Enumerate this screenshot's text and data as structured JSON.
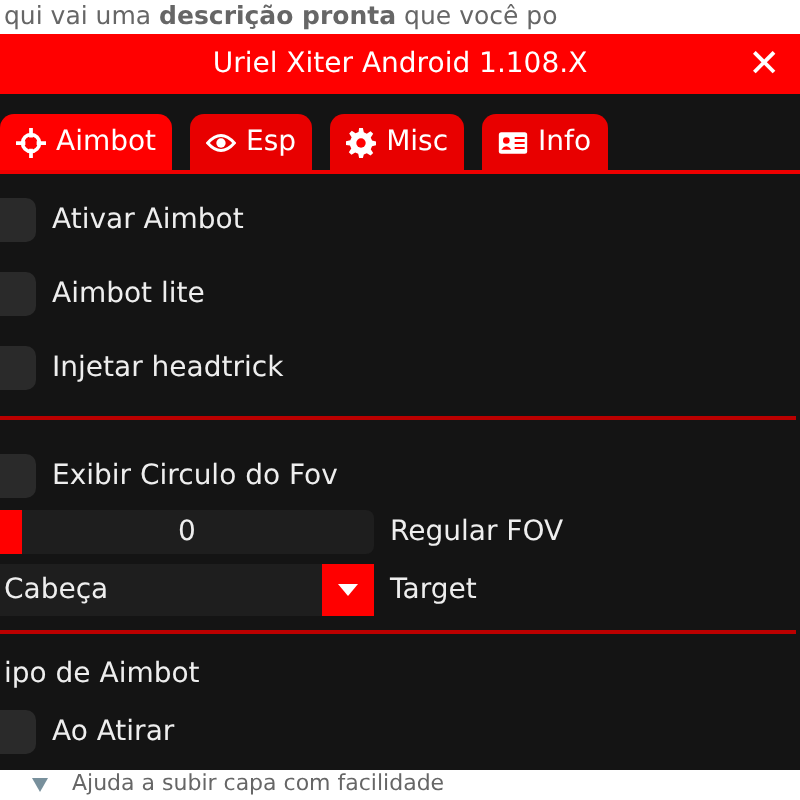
{
  "page_text_top": "qui vai uma **descrição pronta** que você po",
  "window": {
    "title": "Uriel Xiter Android 1.108.X",
    "close": "✕"
  },
  "tabs": [
    {
      "label": "Aimbot",
      "selected": true
    },
    {
      "label": "Esp",
      "selected": false
    },
    {
      "label": "Misc",
      "selected": false
    },
    {
      "label": "Info",
      "selected": false
    }
  ],
  "items": [
    {
      "kind": "checkbox",
      "label": "Ativar Aimbot",
      "checked": false
    },
    {
      "kind": "checkbox",
      "label": "Aimbot lite",
      "checked": false
    },
    {
      "kind": "checkbox",
      "label": "Injetar headtrick",
      "checked": false
    },
    {
      "kind": "divider"
    },
    {
      "kind": "checkbox",
      "label": "Exibir Circulo do Fov",
      "checked": false
    },
    {
      "kind": "slider",
      "reading": "0",
      "label": "Regular FOV",
      "level": 0
    },
    {
      "kind": "dropdown",
      "value": "Cabeça",
      "label": "Target"
    },
    {
      "kind": "divider"
    },
    {
      "kind": "heading",
      "label": "ipo de Aimbot"
    },
    {
      "kind": "checkbox",
      "label": "Ao Atirar",
      "checked": false
    }
  ],
  "page_text_bottom": "Ajuda a subir capa com facilidade"
}
